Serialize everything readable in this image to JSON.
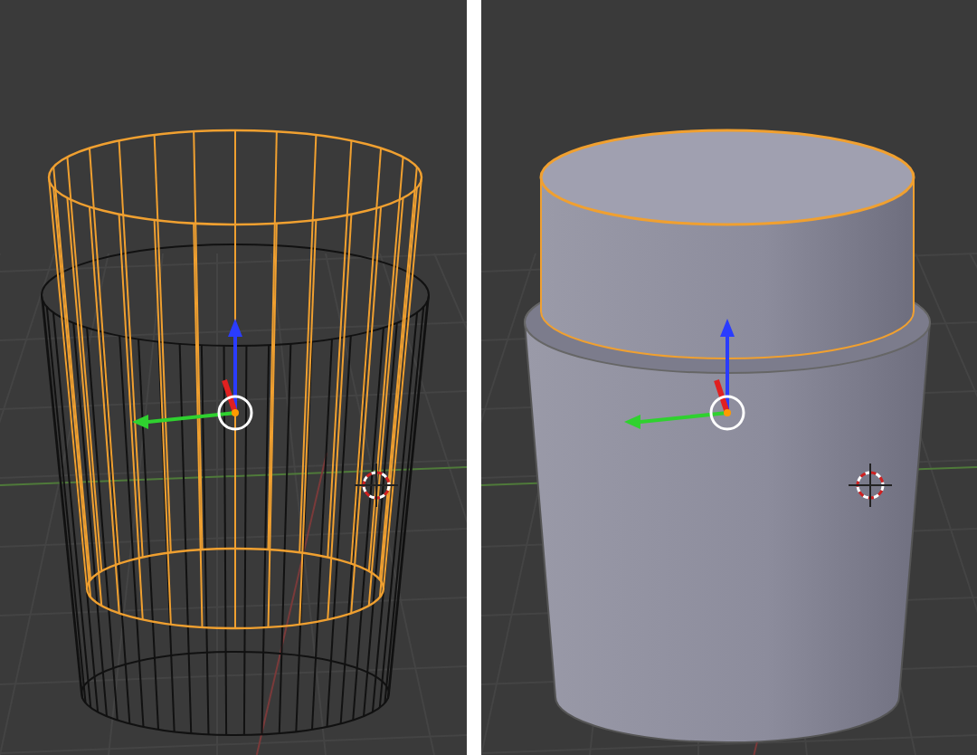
{
  "viewports": [
    {
      "kind": "wireframe"
    },
    {
      "kind": "solid"
    }
  ]
}
